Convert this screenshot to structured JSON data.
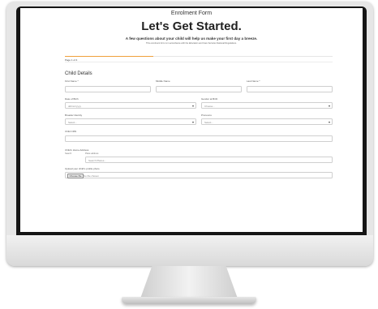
{
  "form": {
    "window_title": "Enrolment Form",
    "headline": "Let's Get Started.",
    "subtitle": "A few questions about your child will help us make your first day a breeze.",
    "fine_print": "This enrolment form is in accordance with the Education and Care Services National Regulations.",
    "progress": 0.33,
    "page_indicator": "Page 1 of 4",
    "section_title": "Child Details",
    "fields": {
      "first_name": {
        "label": "First Name *"
      },
      "middle_name": {
        "label": "Middle Name"
      },
      "last_name": {
        "label": "Last Name *"
      },
      "dob": {
        "label": "Date of Birth",
        "placeholder": "dd/mm/yyyy"
      },
      "gender": {
        "label": "Gender at Birth",
        "placeholder": "Choose..."
      },
      "ethnicity": {
        "label": "Broader Identity",
        "placeholder": "Select..."
      },
      "pronouns": {
        "label": "Pronouns",
        "placeholder": "Select..."
      },
      "crn": {
        "label": "Child CRN"
      },
      "address": {
        "label": "Child's Home Address",
        "sublabel_1": "Search",
        "sublabel_2": "Place address",
        "placeholder": "Search Places..."
      },
      "photo": {
        "label": "Upload your child's profile photo",
        "button": "Choose file",
        "status": "No file chosen"
      }
    }
  }
}
